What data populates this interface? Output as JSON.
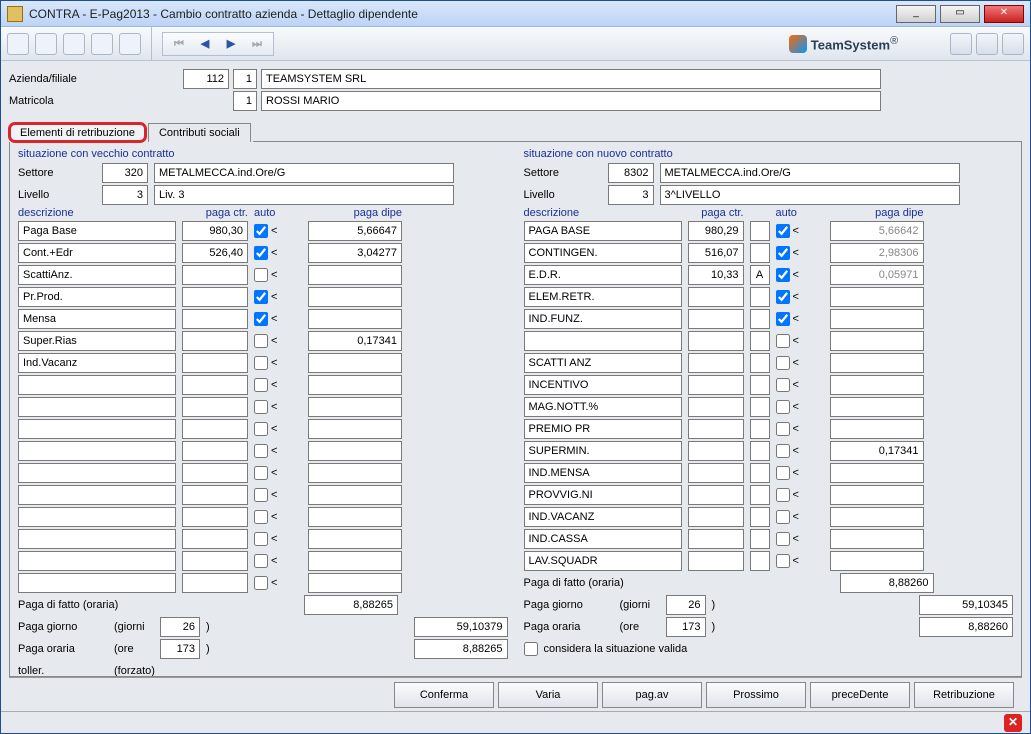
{
  "window": {
    "title": "CONTRA  -  E-Pag2013   -  Cambio contratto azienda - Dettaglio dipendente"
  },
  "brand": "TeamSystem",
  "header": {
    "azienda_label": "Azienda/filiale",
    "azienda_code": "112",
    "azienda_sub": "1",
    "azienda_name": "TEAMSYSTEM SRL",
    "matricola_label": "Matricola",
    "matricola_code": "1",
    "matricola_name": "ROSSI MARIO"
  },
  "tabs": {
    "t1": "Elementi di retribuzione",
    "t2": "Contributi sociali"
  },
  "left": {
    "title": "situazione con vecchio contratto",
    "settore_label": "Settore",
    "settore_code": "320",
    "settore_name": "METALMECCA.ind.Ore/G",
    "livello_label": "Livello",
    "livello_code": "3",
    "livello_name": "Liv. 3",
    "col_desc": "descrizione",
    "col_paga": "paga ctr.",
    "col_auto": "auto",
    "col_dipe": "paga dipe",
    "rows": [
      {
        "d": "Paga Base",
        "p": "980,30",
        "a": true,
        "dp": "5,66647"
      },
      {
        "d": "Cont.+Edr",
        "p": "526,40",
        "a": true,
        "dp": "3,04277"
      },
      {
        "d": "ScattiAnz.",
        "p": "",
        "a": false,
        "dp": ""
      },
      {
        "d": "Pr.Prod.",
        "p": "",
        "a": true,
        "dp": ""
      },
      {
        "d": "Mensa",
        "p": "",
        "a": true,
        "dp": ""
      },
      {
        "d": "Super.Rias",
        "p": "",
        "a": false,
        "dp": "0,17341"
      },
      {
        "d": "Ind.Vacanz",
        "p": "",
        "a": false,
        "dp": ""
      },
      {
        "d": "",
        "p": "",
        "a": false,
        "dp": ""
      },
      {
        "d": "",
        "p": "",
        "a": false,
        "dp": ""
      },
      {
        "d": "",
        "p": "",
        "a": false,
        "dp": ""
      },
      {
        "d": "",
        "p": "",
        "a": false,
        "dp": ""
      },
      {
        "d": "",
        "p": "",
        "a": false,
        "dp": ""
      },
      {
        "d": "",
        "p": "",
        "a": false,
        "dp": ""
      },
      {
        "d": "",
        "p": "",
        "a": false,
        "dp": ""
      },
      {
        "d": "",
        "p": "",
        "a": false,
        "dp": ""
      },
      {
        "d": "",
        "p": "",
        "a": false,
        "dp": ""
      },
      {
        "d": "",
        "p": "",
        "a": false,
        "dp": ""
      }
    ],
    "pdf_label": "Paga di fatto (oraria)",
    "pdf_val": "8,88265",
    "pg_label": "Paga giorno",
    "pg_unit": "(giorni",
    "pg_days": "26",
    "pg_close": ")",
    "pg_val": "59,10379",
    "po_label": "Paga oraria",
    "po_unit": "(ore",
    "po_hours": "173",
    "po_close": ")",
    "po_val": "8,88265",
    "toll_label": "toller.",
    "toll_note": "(forzato)"
  },
  "right": {
    "title": "situazione con nuovo contratto",
    "settore_label": "Settore",
    "settore_code": "8302",
    "settore_name": "METALMECCA.ind.Ore/G",
    "livello_label": "Livello",
    "livello_code": "3",
    "livello_name": "3^LIVELLO",
    "col_desc": "descrizione",
    "col_paga": "paga ctr.",
    "col_auto": "auto",
    "col_dipe": "paga dipe",
    "rows": [
      {
        "d": "PAGA BASE",
        "p": "980,29",
        "x": "",
        "a": true,
        "dp": "5,66642"
      },
      {
        "d": "CONTINGEN.",
        "p": "516,07",
        "x": "",
        "a": true,
        "dp": "2,98306"
      },
      {
        "d": "E.D.R.",
        "p": "10,33",
        "x": "A",
        "a": true,
        "dp": "0,05971"
      },
      {
        "d": "ELEM.RETR.",
        "p": "",
        "x": "",
        "a": true,
        "dp": ""
      },
      {
        "d": "IND.FUNZ.",
        "p": "",
        "x": "",
        "a": true,
        "dp": ""
      },
      {
        "d": "",
        "p": "",
        "x": "",
        "a": false,
        "dp": ""
      },
      {
        "d": "SCATTI ANZ",
        "p": "",
        "x": "",
        "a": false,
        "dp": ""
      },
      {
        "d": "INCENTIVO",
        "p": "",
        "x": "",
        "a": false,
        "dp": ""
      },
      {
        "d": "MAG.NOTT.%",
        "p": "",
        "x": "",
        "a": false,
        "dp": ""
      },
      {
        "d": "PREMIO PR",
        "p": "",
        "x": "",
        "a": false,
        "dp": ""
      },
      {
        "d": "SUPERMIN.",
        "p": "",
        "x": "",
        "a": false,
        "dp": "0,17341"
      },
      {
        "d": "IND.MENSA",
        "p": "",
        "x": "",
        "a": false,
        "dp": ""
      },
      {
        "d": "PROVVIG.NI",
        "p": "",
        "x": "",
        "a": false,
        "dp": ""
      },
      {
        "d": "IND.VACANZ",
        "p": "",
        "x": "",
        "a": false,
        "dp": ""
      },
      {
        "d": "IND.CASSA",
        "p": "",
        "x": "",
        "a": false,
        "dp": ""
      },
      {
        "d": "LAV.SQUADR",
        "p": "",
        "x": "",
        "a": false,
        "dp": ""
      }
    ],
    "pdf_label": "Paga di fatto (oraria)",
    "pdf_val": "8,88260",
    "pg_label": "Paga giorno",
    "pg_unit": "(giorni",
    "pg_days": "26",
    "pg_close": ")",
    "pg_val": "59,10345",
    "po_label": "Paga oraria",
    "po_unit": "(ore",
    "po_hours": "173",
    "po_close": ")",
    "po_val": "8,88260",
    "valid_label": "considera la situazione valida"
  },
  "buttons": {
    "conferma": "Conferma",
    "varia": "Varia",
    "pagav": "pag.av",
    "prossimo": "Prossimo",
    "precedente": "preceDente",
    "retribuzione": "Retribuzione"
  }
}
